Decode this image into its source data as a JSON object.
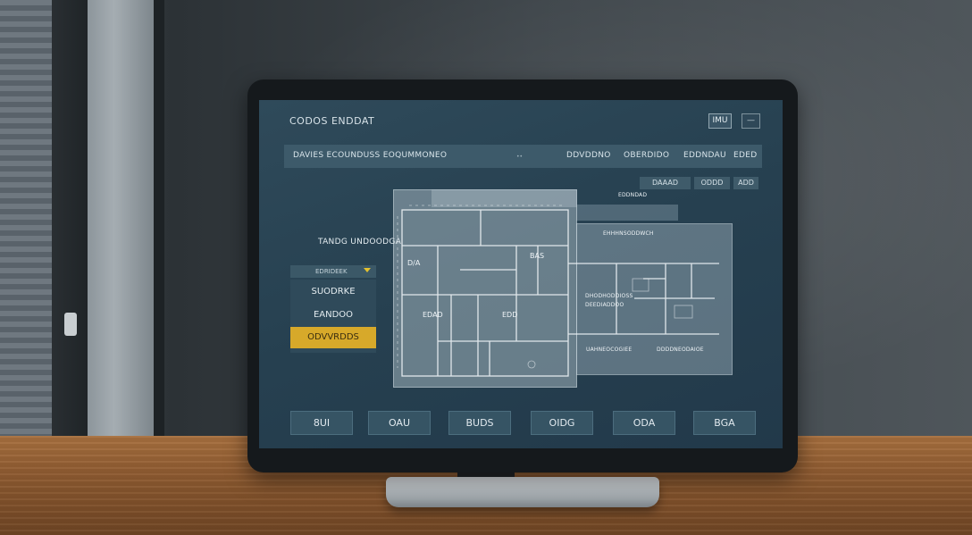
{
  "app": {
    "title": "CODOS ENDDAT",
    "window_buttons": [
      "IMU",
      "—"
    ]
  },
  "toolbar": {
    "label": "DAVIES ECOUNDUSS EOQUMMONEO",
    "dot": "••",
    "items": [
      "DDVDDNO",
      "OBERDIDO",
      "EDDNDAU",
      "EDED"
    ]
  },
  "sub_toolbar": [
    "DAAAD",
    "ODDD",
    "ADD"
  ],
  "floor_plan": {
    "header_label": "EDDNDAD",
    "side_labels": [
      "EHHHNSODDWCH",
      "DHODHODDIOSS",
      "DEEDIADDOO",
      "UAHNEOCOGIEE",
      "DDDDNEODAIOE"
    ],
    "room_labels": [
      "D/A",
      "BAS",
      "EDAD",
      "EDD"
    ]
  },
  "left_panel": {
    "title": "TANDG UNDOODGA",
    "dropdown_header": "EDRIDEEK",
    "options": [
      "SUODRKE",
      "EANDOO"
    ],
    "selected": "ODVVRDDS"
  },
  "bottom_nav": [
    "8UI",
    "OAU",
    "BUDS",
    "OIDG",
    "ODA",
    "BGA"
  ],
  "colors": {
    "screen": "#264050",
    "accent": "#d7a92a",
    "panel": "#3d5a6a"
  }
}
